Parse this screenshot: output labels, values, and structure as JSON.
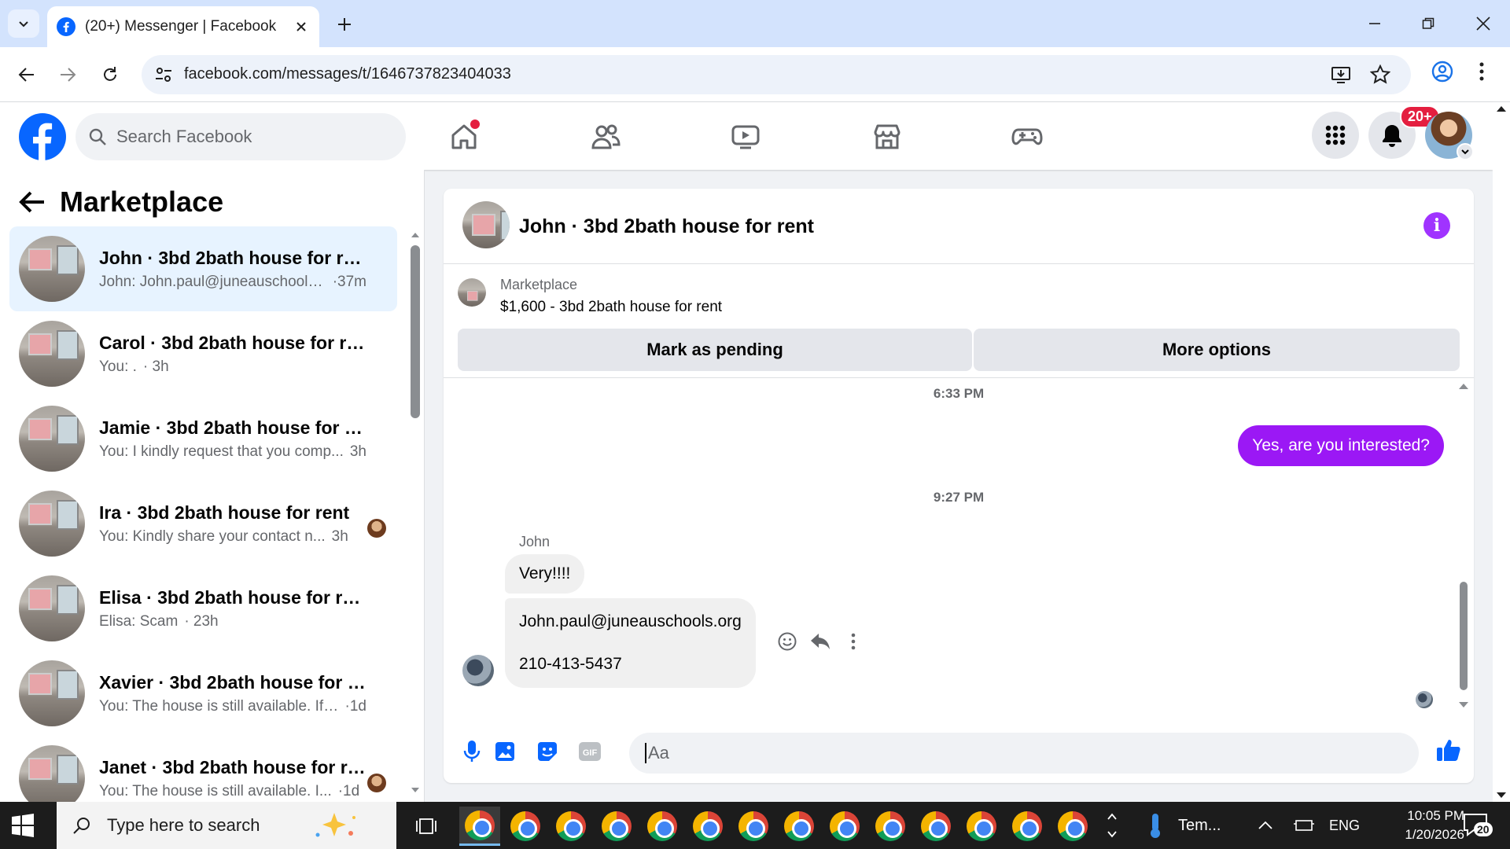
{
  "browser": {
    "tab_title": "(20+) Messenger | Facebook",
    "url": "facebook.com/messages/t/1646737823404033"
  },
  "fb": {
    "search_placeholder": "Search Facebook",
    "notif_badge": "20+"
  },
  "sidebar": {
    "title": "Marketplace",
    "conversations": [
      {
        "name": "John · 3bd 2bath house for rent",
        "snippet": "John: John.paul@juneauschools....",
        "time": "·37m",
        "active": true
      },
      {
        "name": "Carol · 3bd 2bath house for rent",
        "snippet": "You: . ",
        "time": "· 3h"
      },
      {
        "name": "Jamie · 3bd 2bath house for rent",
        "snippet": "You: I kindly request that you comp...",
        "time": "3h"
      },
      {
        "name": "Ira · 3bd 2bath house for rent",
        "snippet": "You: Kindly share your contact n...",
        "time": "3h"
      },
      {
        "name": "Elisa · 3bd 2bath house for rent",
        "snippet": "Elisa: Scam",
        "time": "· 23h"
      },
      {
        "name": "Xavier · 3bd 2bath house for rent",
        "snippet": "You: The house is still available. If y...",
        "time": "·1d"
      },
      {
        "name": "Janet · 3bd 2bath house for re...",
        "snippet": "You: The house is still available. I...",
        "time": "·1d"
      }
    ]
  },
  "chat": {
    "title": "John · 3bd 2bath house for rent",
    "marketplace_label": "Marketplace",
    "listing": "$1,600 - 3bd 2bath house for rent",
    "mark_pending": "Mark as pending",
    "more_options": "More options",
    "ts1": "6:33 PM",
    "outgoing": "Yes, are you interested?",
    "ts2": "9:27 PM",
    "sender": "John",
    "incoming1": "Very!!!!",
    "incoming2_line1": "John.paul@juneauschools.org",
    "incoming2_line2": "210-413-5437",
    "composer_placeholder": "Aa"
  },
  "taskbar": {
    "search_placeholder": "Type here to search",
    "weather": "Tem...",
    "lang": "ENG",
    "time": "10:05 PM",
    "date": "1/20/2026",
    "notif_count": "20"
  },
  "colors": {
    "fb_blue": "#0866ff",
    "messenger_purple": "#9b18f5",
    "active_row": "#e7f3ff"
  }
}
